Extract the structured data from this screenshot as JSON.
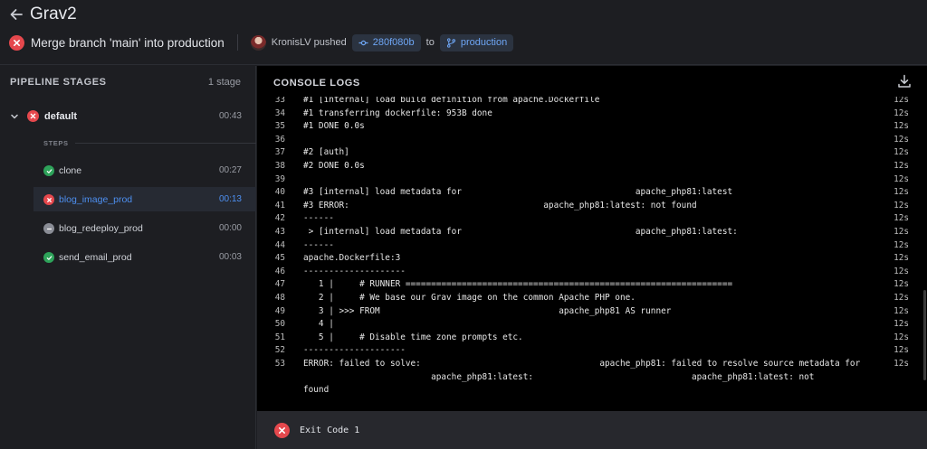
{
  "header": {
    "back_icon": "arrow-left-icon",
    "repo_title": "Grav2",
    "status_icon": "x-circle-icon",
    "status_color": "#e5484d",
    "commit_message": "Merge branch 'main' into production",
    "author": "KronisLV",
    "pushed_label": "pushed",
    "commit_sha": "280f080b",
    "to_label": "to",
    "branch": "production"
  },
  "sidebar": {
    "title": "PIPELINE STAGES",
    "stage_count": "1 stage",
    "stage": {
      "name": "default",
      "time": "00:43",
      "status": "failure"
    },
    "steps_label": "STEPS",
    "steps": [
      {
        "name": "clone",
        "time": "00:27",
        "status": "success"
      },
      {
        "name": "blog_image_prod",
        "time": "00:13",
        "status": "failure",
        "active": true
      },
      {
        "name": "blog_redeploy_prod",
        "time": "00:00",
        "status": "skipped"
      },
      {
        "name": "send_email_prod",
        "time": "00:03",
        "status": "success"
      }
    ]
  },
  "console": {
    "title": "CONSOLE LOGS",
    "download_icon": "download-icon",
    "lines": [
      {
        "n": "33",
        "t": "#1 [internal] load build definition from apache.Dockerfile",
        "ts": "12s"
      },
      {
        "n": "34",
        "t": "#1 transferring dockerfile: 953B done",
        "ts": "12s"
      },
      {
        "n": "35",
        "t": "#1 DONE 0.0s",
        "ts": "12s"
      },
      {
        "n": "36",
        "t": "",
        "ts": "12s"
      },
      {
        "n": "37",
        "t": "#2 [auth]",
        "ts": "12s"
      },
      {
        "n": "38",
        "t": "#2 DONE 0.0s",
        "ts": "12s"
      },
      {
        "n": "39",
        "t": "",
        "ts": "12s"
      },
      {
        "n": "40",
        "t": "#3 [internal] load metadata for                                  apache_php81:latest",
        "ts": "12s"
      },
      {
        "n": "41",
        "t": "#3 ERROR:                                      apache_php81:latest: not found",
        "ts": "12s"
      },
      {
        "n": "42",
        "t": "------",
        "ts": "12s"
      },
      {
        "n": "43",
        "t": " > [internal] load metadata for                                  apache_php81:latest:",
        "ts": "12s"
      },
      {
        "n": "44",
        "t": "------",
        "ts": "12s"
      },
      {
        "n": "45",
        "t": "apache.Dockerfile:3",
        "ts": "12s"
      },
      {
        "n": "46",
        "t": "--------------------",
        "ts": "12s"
      },
      {
        "n": "47",
        "t": "   1 |     # RUNNER ================================================================",
        "ts": "12s"
      },
      {
        "n": "48",
        "t": "   2 |     # We base our Grav image on the common Apache PHP one.",
        "ts": "12s"
      },
      {
        "n": "49",
        "t": "   3 | >>> FROM                                   apache_php81 AS runner",
        "ts": "12s"
      },
      {
        "n": "50",
        "t": "   4 |",
        "ts": "12s"
      },
      {
        "n": "51",
        "t": "   5 |     # Disable time zone prompts etc.",
        "ts": "12s"
      },
      {
        "n": "52",
        "t": "--------------------",
        "ts": "12s"
      },
      {
        "n": "53",
        "t": "ERROR: failed to solve:                                   apache_php81: failed to resolve source metadata for",
        "ts": "12s"
      },
      {
        "n": "",
        "t": "                         apache_php81:latest:                               apache_php81:latest: not",
        "ts": ""
      },
      {
        "n": "",
        "t": "found",
        "ts": ""
      }
    ]
  },
  "exit": {
    "icon": "x-circle-icon",
    "label": "Exit Code 1"
  }
}
